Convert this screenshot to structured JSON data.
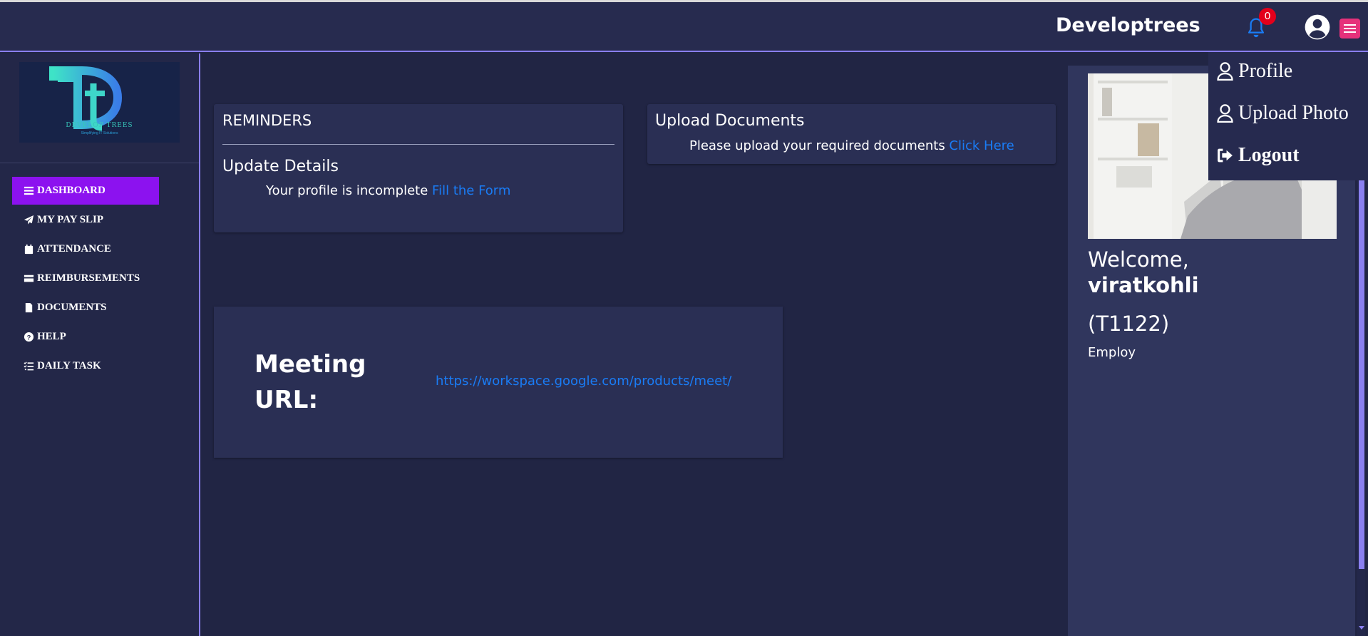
{
  "header": {
    "brand": "Developtrees",
    "notification_count": "0"
  },
  "logo": {
    "text": "DEVELOP TREES",
    "tagline": "Simplifying IT Solutions"
  },
  "sidebar": {
    "items": [
      {
        "label": "DASHBOARD",
        "icon": "bars-icon",
        "active": true
      },
      {
        "label": "MY PAY SLIP",
        "icon": "paper-plane-icon"
      },
      {
        "label": "ATTENDANCE",
        "icon": "calendar-icon"
      },
      {
        "label": "REIMBURSEMENTS",
        "icon": "credit-card-icon"
      },
      {
        "label": "DOCUMENTS",
        "icon": "file-icon"
      },
      {
        "label": "HELP",
        "icon": "question-circle-icon"
      },
      {
        "label": "DAILY TASK",
        "icon": "task-list-icon"
      }
    ]
  },
  "reminders": {
    "title": "REMINDERS",
    "subtitle": "Update Details",
    "text": "Your profile is incomplete ",
    "link": "Fill the Form"
  },
  "upload": {
    "title": "Upload Documents",
    "text": "Please upload your required documents ",
    "link": "Click Here"
  },
  "meeting": {
    "label": "Meeting URL:",
    "url": "https://workspace.google.com/products/meet/"
  },
  "profile_panel": {
    "welcome": "Welcome,",
    "username": "viratkohli",
    "employee_id": "(T1122)",
    "role": "Employ"
  },
  "dropdown": {
    "items": [
      {
        "label": "Profile",
        "icon": "user-outline-icon"
      },
      {
        "label": "Upload Photo",
        "icon": "user-outline-icon"
      },
      {
        "label": "Logout",
        "icon": "sign-out-icon"
      }
    ]
  },
  "colors": {
    "accent": "#8c12ef",
    "link": "#1a7cf5",
    "menu_button": "#e6317b",
    "badge": "#e3001b"
  }
}
